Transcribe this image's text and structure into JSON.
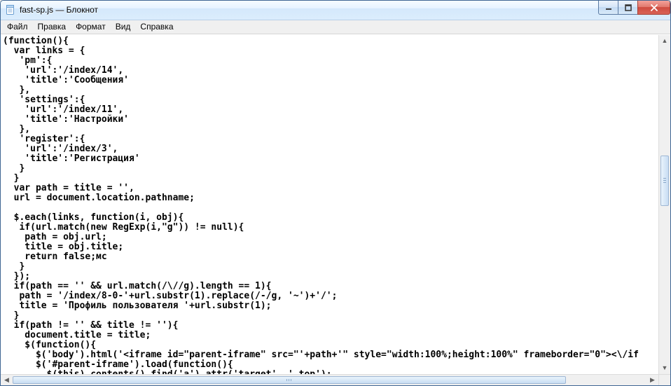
{
  "window": {
    "title": "fast-sp.js — Блокнот",
    "app_icon": "notepad-icon"
  },
  "menu": {
    "items": [
      {
        "label": "Файл"
      },
      {
        "label": "Правка"
      },
      {
        "label": "Формат"
      },
      {
        "label": "Вид"
      },
      {
        "label": "Справка"
      }
    ]
  },
  "editor": {
    "content": "(function(){\n  var links = {\n   'pm':{\n    'url':'/index/14',\n    'title':'Сообщения'\n   },\n   'settings':{\n    'url':'/index/11',\n    'title':'Настройки'\n   },\n   'register':{\n    'url':'/index/3',\n    'title':'Регистрация'\n   }\n  }\n  var path = title = '',\n  url = document.location.pathname;\n\n  $.each(links, function(i, obj){\n   if(url.match(new RegExp(i,\"g\")) != null){\n    path = obj.url;\n    title = obj.title;\n    return false;мс\n   }\n  });\n  if(path == '' && url.match(/\\//g).length == 1){\n   path = '/index/8-0-'+url.substr(1).replace(/-/g, '~')+'/';\n   title = 'Профиль пользователя '+url.substr(1);\n  }\n  if(path != '' && title != ''){\n    document.title = title;\n    $(function(){\n      $('body').html('<iframe id=\"parent-iframe\" src=\"'+path+'\" style=\"width:100%;height:100%\" frameborder=\"0\"><\\/if\n      $('#parent-iframe').load(function(){\n        $(this).contents().find('a').attr('target', '_top');\n      });"
  },
  "title_controls": {
    "minimize": "minimize",
    "maximize": "maximize",
    "close": "close"
  }
}
